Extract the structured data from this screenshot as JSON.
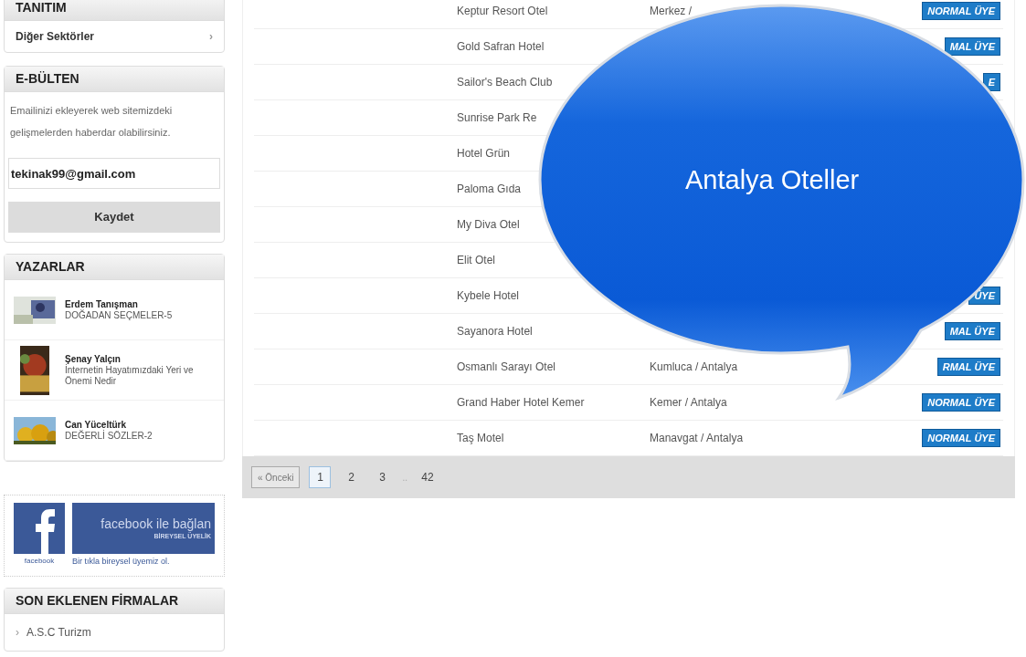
{
  "sidebar": {
    "tanitim": {
      "title": "TANITIM",
      "items": [
        {
          "label": "Diğer Sektörler",
          "arrow": "›"
        }
      ]
    },
    "ebulten": {
      "title": "E-BÜLTEN",
      "text": "Emailinizi ekleyerek web sitemizdeki gelişmelerden haberdar olabilirsiniz.",
      "email": "tekinak99@gmail.com",
      "button": "Kaydet"
    },
    "yazarlar": {
      "title": "YAZARLAR",
      "authors": [
        {
          "name": "Erdem Tanışman",
          "article": "DOĞADAN SEÇMELER-5"
        },
        {
          "name": "Şenay Yalçın",
          "article": "İnternetin Hayatımızdaki Yeri ve Önemi Nedir"
        },
        {
          "name": "Can Yüceltürk",
          "article": "DEĞERLİ SÖZLER-2"
        }
      ]
    },
    "facebook": {
      "logo_caption": "facebook",
      "banner_title": "facebook ile bağlan",
      "banner_subtitle": "BİREYSEL ÜYELİK",
      "caption": "Bir tıkla bireysel üyemiz ol."
    },
    "son_eklenen": {
      "title": "SON EKLENEN FİRMALAR",
      "items": [
        {
          "label": "A.S.C Turizm",
          "arrow": "›"
        }
      ]
    }
  },
  "table": {
    "rows": [
      {
        "name": "Keptur Resort Otel",
        "location": "Merkez /",
        "badge": "NORMAL ÜYE"
      },
      {
        "name": "Gold Safran Hotel",
        "badge": "MAL ÜYE"
      },
      {
        "name": "Sailor's Beach Club",
        "badge": "E"
      },
      {
        "name": "Sunrise Park Re"
      },
      {
        "name": "Hotel Grün"
      },
      {
        "name": "Paloma Gıda"
      },
      {
        "name": "My Diva Otel"
      },
      {
        "name": "Elit Otel"
      },
      {
        "name": "Kybele Hotel",
        "badge": "ÜYE"
      },
      {
        "name": "Sayanora Hotel",
        "badge": "MAL ÜYE"
      },
      {
        "name": "Osmanlı Sarayı Otel",
        "location": "Kumluca / Antalya",
        "badge": "RMAL ÜYE"
      },
      {
        "name": "Grand Haber Hotel Kemer",
        "location": "Kemer / Antalya",
        "badge": "NORMAL ÜYE"
      },
      {
        "name": "Taş Motel",
        "location": "Manavgat / Antalya",
        "badge": "NORMAL ÜYE"
      }
    ]
  },
  "pagination": {
    "previous": {
      "label": "« Önceki",
      "disabled": true
    },
    "pages": [
      {
        "label": "1",
        "selected": true
      },
      {
        "label": "2",
        "selected": false
      },
      {
        "label": "3",
        "selected": false
      },
      {
        "label": "..",
        "kind": "gap"
      },
      {
        "label": "42",
        "selected": false
      }
    ]
  },
  "callout": {
    "text": "Antalya Oteller"
  }
}
